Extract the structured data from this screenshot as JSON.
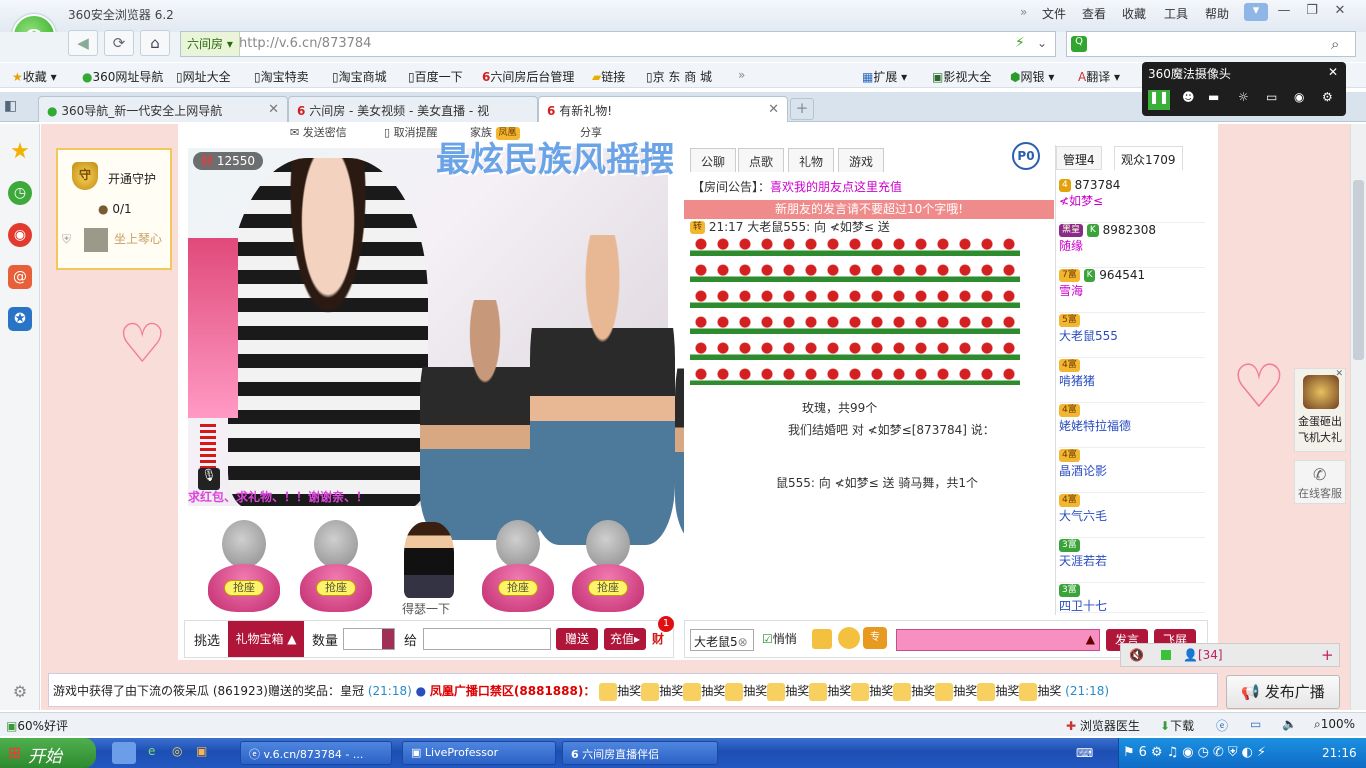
{
  "browser": {
    "title": "360安全浏览器 6.2",
    "menus": [
      "文件",
      "查看",
      "收藏",
      "工具",
      "帮助"
    ],
    "site_label": "六间房",
    "url": "http://v.6.cn/873784",
    "bookmarks": [
      "收藏",
      "360网址导航",
      "网址大全",
      "淘宝特卖",
      "淘宝商城",
      "百度一下",
      "六间房后台管理",
      "链接",
      "京 东 商 城"
    ],
    "extras": [
      "扩展",
      "影视大全",
      "网银",
      "翻译"
    ],
    "tabs": [
      "360导航_新一代安全上网导航",
      "六间房 - 美女视频 - 美女直播 - 视",
      "有新礼物!"
    ]
  },
  "magic_camera": {
    "title": "360魔法摄像头"
  },
  "room": {
    "top_links": [
      "发送密信",
      "取消提醒",
      "家族",
      "分享"
    ],
    "guard_title": "开通守护",
    "guard_count": "0/1",
    "guard_seat": "坐上琴心",
    "wealth": "12550",
    "overlay_title": "最炫民族风摇摆",
    "video_scroll": "求红包、求礼物、！！谢谢亲、！",
    "seats": [
      "抢座",
      "抢座",
      "抢座",
      "抢座"
    ],
    "seat_user": "得瑟一下",
    "chat_tabs": [
      "公聊",
      "点歌",
      "礼物",
      "游戏"
    ],
    "p_badge": "P0",
    "notice_prefix": "【房间公告】：",
    "notice_text": "喜欢我的朋友点这里充值",
    "newuser_tip": "新朋友的发言请不要超过10个字哦!",
    "msg1": "21:17 大老鼠555: 向 ≮如梦≤ 送",
    "msg2": "玫瑰，共99个",
    "msg3": "我们结婚吧 对 ≮如梦≤[873784] 说：",
    "msg4": "鼠555: 向 ≮如梦≤ 送",
    "msg4b": "骑马舞，共1个",
    "list_tabs": [
      "管理4",
      "观众1709"
    ],
    "users": [
      {
        "badge": "4",
        "name": "873784",
        "nick": "≮如梦≤"
      },
      {
        "badge": "黑皇",
        "name": "8982308",
        "nick": "随缘"
      },
      {
        "badge": "7富",
        "name": "964541",
        "nick": "雪海"
      },
      {
        "badge": "5富",
        "name": "大老鼠555",
        "nick": ""
      },
      {
        "badge": "4富",
        "name": "啃猪猪",
        "nick": ""
      },
      {
        "badge": "4富",
        "name": "姥姥特拉福德",
        "nick": ""
      },
      {
        "badge": "4富",
        "name": "晶酒论影",
        "nick": ""
      },
      {
        "badge": "4富",
        "name": "大气六毛",
        "nick": ""
      },
      {
        "badge": "3富",
        "name": "天涯若若",
        "nick": ""
      },
      {
        "badge": "3富",
        "name": "四卫十七",
        "nick": ""
      }
    ],
    "gift": {
      "pick": "挑选",
      "box": "礼物宝箱",
      "qty_label": "数量",
      "to_label": "给",
      "give": "赠送",
      "recharge": "充值",
      "cai": "财",
      "cai_badge": "1"
    },
    "chat_input": {
      "target": "大老鼠5",
      "quiet": "悄悄",
      "send": "发言",
      "fly": "飞屏"
    },
    "online": "[34]",
    "ticker_a": "游戏中获得了由下流の筱呆瓜 (861923)赠送的奖品：皇冠",
    "ticker_time": "(21:18)",
    "ticker_b": "凤凰广播口禁区(8881888)：",
    "ticker_lottery": "抽奖",
    "broadcast": "发布广播",
    "side_ads": [
      "金蛋砸出飞机大礼",
      "在线客服"
    ]
  },
  "status": {
    "left": "60%好评",
    "doctor": "浏览器医生",
    "download": "下载",
    "zoom": "100%"
  },
  "taskbar": {
    "start": "开始",
    "items": [
      "v.6.cn/873784 - ...",
      "LiveProfessor",
      "六间房直播伴侣"
    ],
    "clock": "21:16"
  }
}
